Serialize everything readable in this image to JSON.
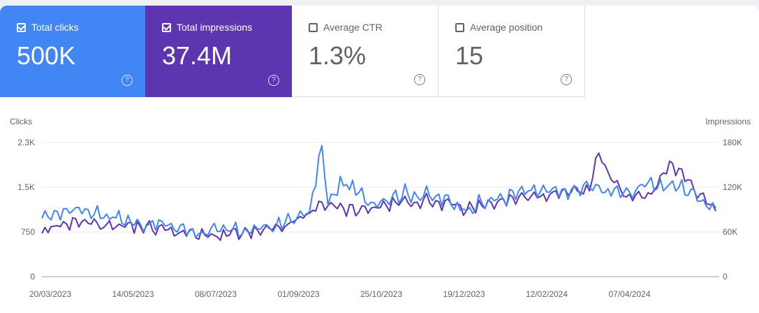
{
  "metrics": [
    {
      "label": "Total clicks",
      "value": "500K",
      "checked": true,
      "color": "#4285f4"
    },
    {
      "label": "Total impressions",
      "value": "37.4M",
      "checked": true,
      "color": "#5e35b1"
    },
    {
      "label": "Average CTR",
      "value": "1.3%",
      "checked": false
    },
    {
      "label": "Average position",
      "value": "15",
      "checked": false
    }
  ],
  "help_glyph": "?",
  "chart_data": {
    "type": "line",
    "left_axis_title": "Clicks",
    "right_axis_title": "Impressions",
    "left_ticks": [
      "0",
      "750",
      "1.5K",
      "2.3K"
    ],
    "right_ticks": [
      "0",
      "60K",
      "120K",
      "180K"
    ],
    "ylim_left": [
      0,
      2250
    ],
    "ylim_right": [
      0,
      180000
    ],
    "x_tick_labels": [
      "20/03/2023",
      "14/05/2023",
      "08/07/2023",
      "01/09/2023",
      "25/10/2023",
      "19/12/2023",
      "12/02/2024",
      "07/04/2024"
    ],
    "x_range": [
      "2023-03-20",
      "2024-05-31"
    ],
    "series": [
      {
        "name": "Clicks",
        "axis": "left",
        "color": "#4285f4",
        "key_points": [
          [
            "2023-03-20",
            980
          ],
          [
            "2023-04-10",
            1150
          ],
          [
            "2023-05-01",
            1050
          ],
          [
            "2023-05-20",
            900
          ],
          [
            "2023-06-10",
            860
          ],
          [
            "2023-07-01",
            740
          ],
          [
            "2023-07-20",
            760
          ],
          [
            "2023-08-10",
            800
          ],
          [
            "2023-08-25",
            900
          ],
          [
            "2023-09-10",
            1100
          ],
          [
            "2023-09-18",
            2200
          ],
          [
            "2023-09-22",
            1200
          ],
          [
            "2023-10-01",
            1600
          ],
          [
            "2023-10-20",
            1250
          ],
          [
            "2023-11-10",
            1400
          ],
          [
            "2023-12-01",
            1350
          ],
          [
            "2023-12-20",
            1150
          ],
          [
            "2024-01-10",
            1300
          ],
          [
            "2024-02-01",
            1450
          ],
          [
            "2024-02-20",
            1400
          ],
          [
            "2024-03-10",
            1500
          ],
          [
            "2024-04-01",
            1400
          ],
          [
            "2024-04-20",
            1550
          ],
          [
            "2024-05-10",
            1500
          ],
          [
            "2024-05-31",
            1150
          ]
        ]
      },
      {
        "name": "Impressions",
        "axis": "right",
        "color": "#5e35b1",
        "key_points": [
          [
            "2023-03-20",
            58000
          ],
          [
            "2023-04-10",
            75000
          ],
          [
            "2023-05-01",
            70000
          ],
          [
            "2023-05-20",
            68000
          ],
          [
            "2023-06-10",
            63000
          ],
          [
            "2023-07-01",
            55000
          ],
          [
            "2023-07-20",
            56000
          ],
          [
            "2023-08-10",
            60000
          ],
          [
            "2023-08-25",
            67000
          ],
          [
            "2023-09-10",
            85000
          ],
          [
            "2023-09-18",
            100000
          ],
          [
            "2023-10-01",
            90000
          ],
          [
            "2023-10-20",
            92000
          ],
          [
            "2023-11-10",
            100000
          ],
          [
            "2023-12-01",
            102000
          ],
          [
            "2023-12-20",
            90000
          ],
          [
            "2024-01-10",
            100000
          ],
          [
            "2024-02-01",
            108000
          ],
          [
            "2024-02-20",
            110000
          ],
          [
            "2024-03-10",
            115000
          ],
          [
            "2024-03-15",
            165000
          ],
          [
            "2024-04-01",
            108000
          ],
          [
            "2024-04-20",
            112000
          ],
          [
            "2024-05-01",
            155000
          ],
          [
            "2024-05-31",
            88000
          ]
        ]
      }
    ]
  }
}
